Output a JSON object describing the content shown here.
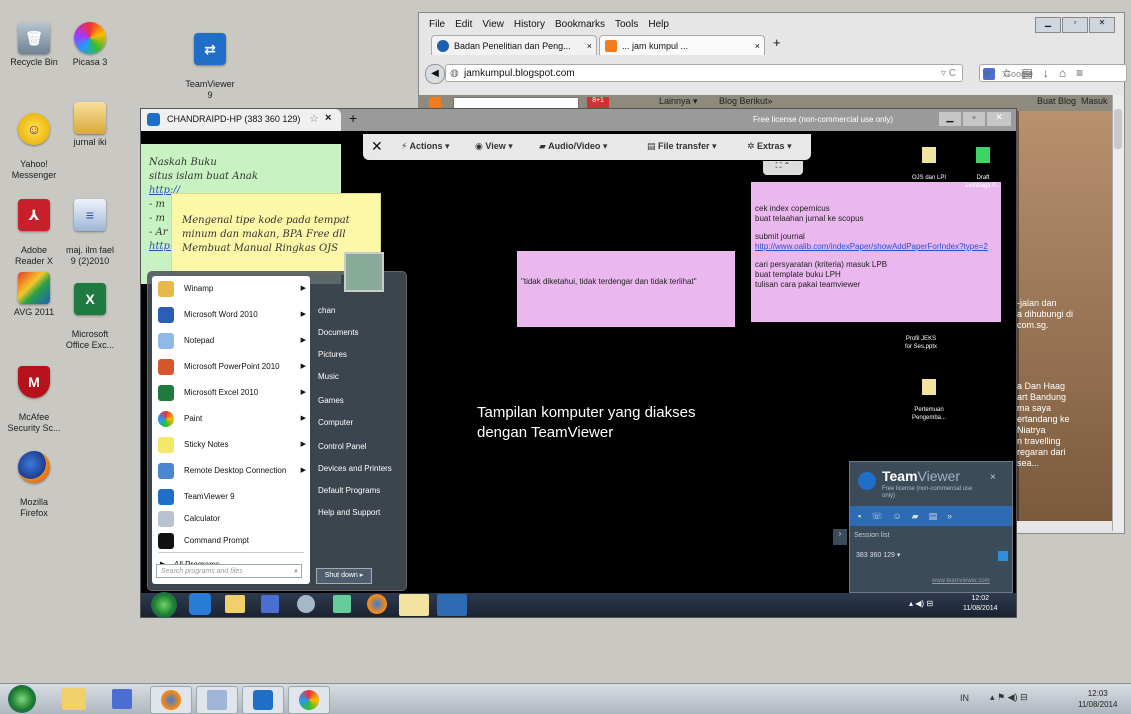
{
  "desktop_icons": [
    {
      "label": "Recycle Bin"
    },
    {
      "label": "Picasa 3"
    },
    {
      "label": "TeamViewer\n9"
    },
    {
      "label": "Yahoo!\nMessenger"
    },
    {
      "label": "jurnal iki"
    },
    {
      "label": "Adobe\nReader X"
    },
    {
      "label": "maj. ilm fael\n9 (2)2010"
    },
    {
      "label": "AVG 2011"
    },
    {
      "label": "Microsoft\nOffice Exc..."
    },
    {
      "label": "McAfee\nSecurity Sc..."
    },
    {
      "label": "Mozilla\nFirefox"
    }
  ],
  "firefox": {
    "menu": [
      "File",
      "Edit",
      "View",
      "History",
      "Bookmarks",
      "Tools",
      "Help"
    ],
    "tabs": [
      "Badan Penelitian dan Peng...",
      "... jam kumpul ..."
    ],
    "url": "jamkumpul.blogspot.com",
    "search_placeholder": "Google",
    "blog_bar_left": "Lainnya ▾",
    "blog_bar_next": "Blog Berikut»",
    "blog_bar_right": "Buat Blog  Masuk",
    "side_text": [
      "-jalan dan",
      "a dihubungi di",
      "com.sg.",
      "",
      "",
      "a Dan Haag",
      "art Bandung",
      "ma saya",
      "ertandang ke",
      "Niatrya",
      "n travelling",
      "regaran dari",
      "sea..."
    ]
  },
  "teamviewer": {
    "title": "CHANDRAIPD-HP (383 360 129)",
    "license": "Free license (non-commercial use only)",
    "toolbar": [
      "Actions ▾",
      "View ▾",
      "Audio/Video ▾",
      "File transfer ▾",
      "Extras ▾"
    ],
    "caption_line1": "Tampilan komputer yang diakses",
    "caption_line2": "dengan TeamViewer",
    "quote_note": "\"tidak diketahui, tidak terdengar dan tidak terlihat\"",
    "pink_note_lines": [
      "cek index copernicus",
      "buat telaahan jurnal ke scopus",
      "",
      "submit journal",
      "http://www.oalib.com/indexPaper/showAddPaperForIndex?type=2",
      "",
      "cari persyaratan (kriteria) masuk LPB",
      "buat template buku LPH",
      "tulisan cara pakai teamviewer"
    ],
    "green_note": [
      "Naskah Buku",
      "situs islam buat Anak",
      "http://",
      "- m",
      "- m",
      "- Ar",
      "http://"
    ],
    "yellow_note": [
      "Mengenal tipe kode pada tempat",
      "minum dan makan, BPA Free dll",
      "Membuat Manual Ringkas OJS"
    ],
    "remote_icons": [
      "OJS dan LPI",
      "Draft\nLembaga P...",
      "Profil JEKS\nfor Ses.pptx",
      "Pertemuan\nPengemba..."
    ],
    "start_menu_left": [
      "Winamp",
      "Microsoft Word 2010",
      "Notepad",
      "Microsoft PowerPoint 2010",
      "Microsoft Excel 2010",
      "Paint",
      "Sticky Notes",
      "Remote Desktop Connection",
      "TeamViewer 9",
      "Calculator",
      "Command Prompt"
    ],
    "all_programs": "All Programs",
    "search_programs": "Search programs and files",
    "start_menu_right": [
      "chan",
      "Documents",
      "Pictures",
      "Music",
      "Games",
      "Computer",
      "Control Panel",
      "Devices and Printers",
      "Default Programs",
      "Help and Support"
    ],
    "shutdown": "Shut down",
    "remote_time": "12:02",
    "remote_date": "11/08/2014",
    "panel_brand_team": "Team",
    "panel_brand_viewer": "Viewer",
    "panel_license": "Free license (non-commercial use only)",
    "panel_session_list": "Session list",
    "panel_session_id": "383 360 129 ▾",
    "panel_site": "www.teamviewer.com"
  },
  "taskbar": {
    "lang": "IN",
    "time": "12:03",
    "date": "11/08/2014"
  }
}
